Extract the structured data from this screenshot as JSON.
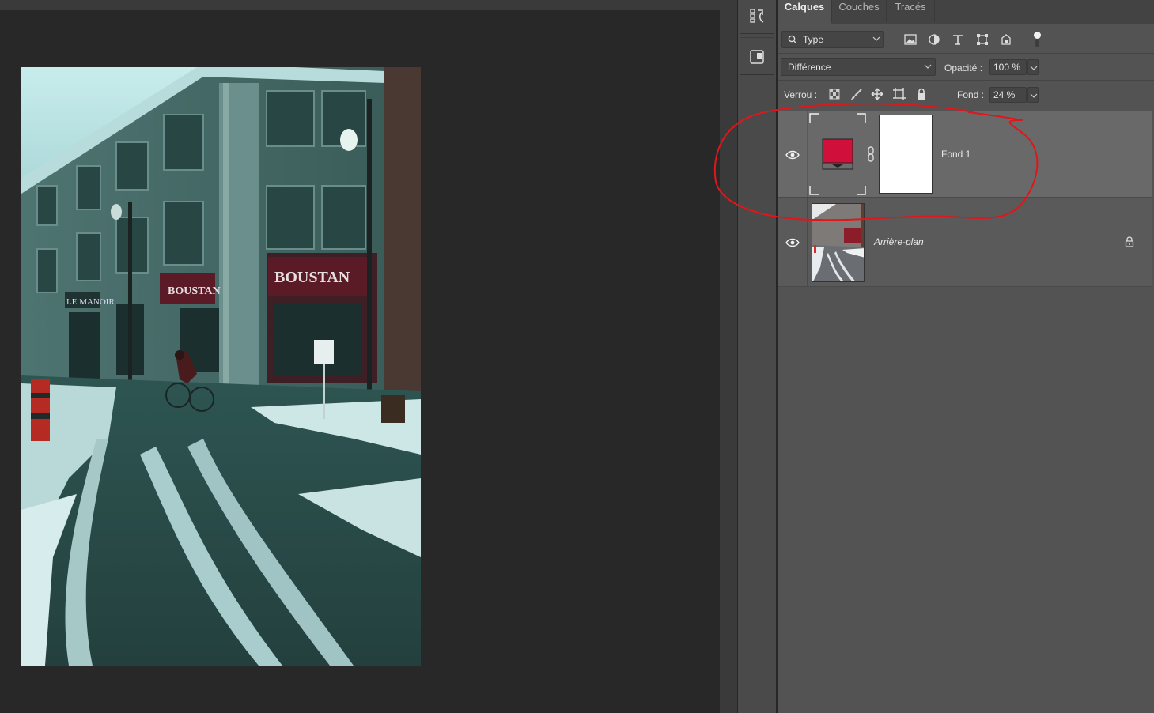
{
  "tabs": [
    {
      "label": "Calques",
      "active": true
    },
    {
      "label": "Couches",
      "active": false
    },
    {
      "label": "Tracés",
      "active": false
    }
  ],
  "filter": {
    "label": "Type",
    "icon": "search-icon"
  },
  "filter_icons": [
    "image-filter-icon",
    "adjustment-filter-icon",
    "type-filter-icon",
    "shape-filter-icon",
    "smart-object-filter-icon",
    "filter-toggle-icon"
  ],
  "blend_mode": {
    "value": "Différence"
  },
  "opacity": {
    "label": "Opacité :",
    "value": "100 %"
  },
  "lock": {
    "label": "Verrou :",
    "icons": [
      "lock-transparency-icon",
      "lock-pixels-icon",
      "lock-position-icon",
      "lock-artboard-icon",
      "lock-all-icon"
    ]
  },
  "fill": {
    "label": "Fond :",
    "value": "24 %"
  },
  "layers": [
    {
      "name": "Fond 1",
      "selected": true,
      "visible": true,
      "fill_color": "#d0103a",
      "has_mask": true
    },
    {
      "name": "Arrière-plan",
      "selected": false,
      "visible": true,
      "locked": true
    }
  ],
  "colors": {
    "accent_fill": "#d0103a",
    "annotation": "#e0161b",
    "panel_bg": "#535353",
    "canvas_bg": "#282828"
  }
}
